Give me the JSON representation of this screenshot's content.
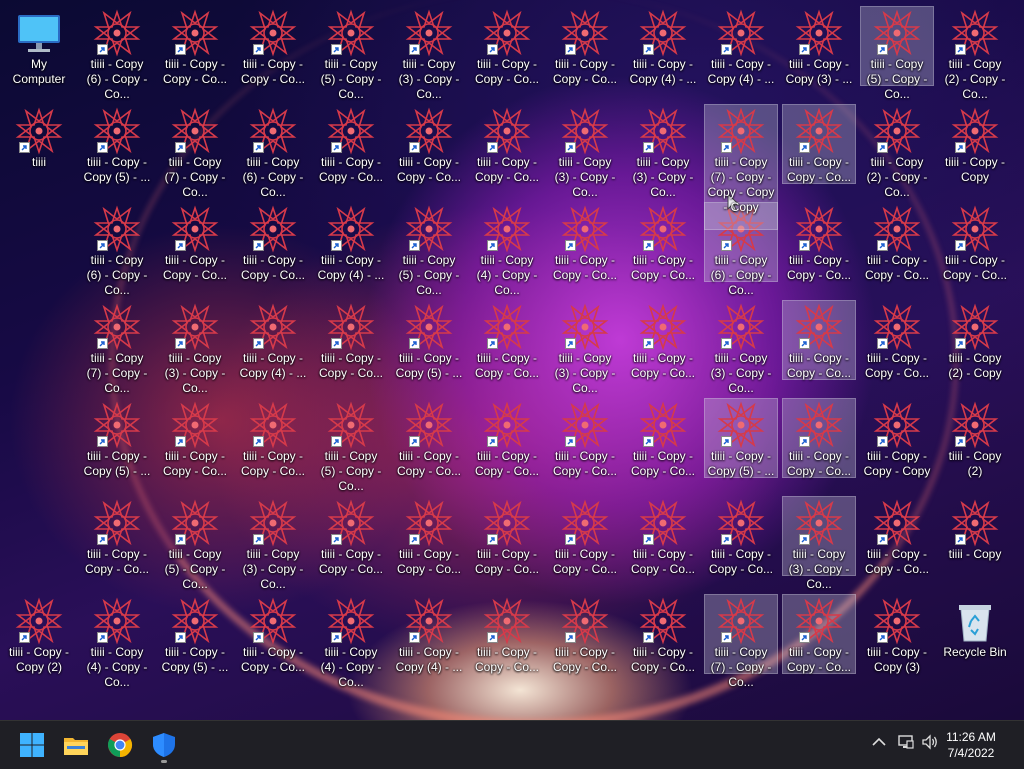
{
  "desktop": {
    "icons": [
      {
        "label": "My Computer",
        "kind": "computer",
        "col": 0,
        "row": 0
      },
      {
        "label": "tiiii - Copy (6) - Copy - Co...",
        "kind": "shortcut",
        "col": 1,
        "row": 0
      },
      {
        "label": "tiiii - Copy - Copy - Co...",
        "kind": "shortcut",
        "col": 2,
        "row": 0
      },
      {
        "label": "tiiii - Copy - Copy - Co...",
        "kind": "shortcut",
        "col": 3,
        "row": 0
      },
      {
        "label": "tiiii - Copy (5) - Copy - Co...",
        "kind": "shortcut",
        "col": 4,
        "row": 0
      },
      {
        "label": "tiiii - Copy (3) - Copy - Co...",
        "kind": "shortcut",
        "col": 5,
        "row": 0
      },
      {
        "label": "tiiii - Copy - Copy - Co...",
        "kind": "shortcut",
        "col": 6,
        "row": 0
      },
      {
        "label": "tiiii - Copy - Copy - Co...",
        "kind": "shortcut",
        "col": 7,
        "row": 0
      },
      {
        "label": "tiiii - Copy - Copy (4) - ...",
        "kind": "shortcut",
        "col": 8,
        "row": 0
      },
      {
        "label": "tiiii - Copy - Copy (4) - ...",
        "kind": "shortcut",
        "col": 9,
        "row": 0
      },
      {
        "label": "tiiii - Copy - Copy (3) - ...",
        "kind": "shortcut",
        "col": 10,
        "row": 0
      },
      {
        "label": "tiiii - Copy (5) - Copy - Co...",
        "kind": "shortcut",
        "col": 11,
        "row": 0,
        "selected": true
      },
      {
        "label": "tiiii - Copy (2) - Copy - Co...",
        "kind": "shortcut",
        "col": 12,
        "row": 0
      },
      {
        "label": "tiiii",
        "kind": "shortcut",
        "col": 0,
        "row": 1
      },
      {
        "label": "tiiii - Copy - Copy (5) - ...",
        "kind": "shortcut",
        "col": 1,
        "row": 1
      },
      {
        "label": "tiiii - Copy (7) - Copy - Co...",
        "kind": "shortcut",
        "col": 2,
        "row": 1
      },
      {
        "label": "tiiii - Copy (6) - Copy - Co...",
        "kind": "shortcut",
        "col": 3,
        "row": 1
      },
      {
        "label": "tiiii - Copy - Copy - Co...",
        "kind": "shortcut",
        "col": 4,
        "row": 1
      },
      {
        "label": "tiiii - Copy - Copy - Co...",
        "kind": "shortcut",
        "col": 5,
        "row": 1
      },
      {
        "label": "tiiii - Copy - Copy - Co...",
        "kind": "shortcut",
        "col": 6,
        "row": 1
      },
      {
        "label": "tiiii - Copy (3) - Copy - Co...",
        "kind": "shortcut",
        "col": 7,
        "row": 1
      },
      {
        "label": "tiiii - Copy (3) - Copy - Co...",
        "kind": "shortcut",
        "col": 8,
        "row": 1
      },
      {
        "label": "tiiii - Copy (7) - Copy - Copy - Copy - Copy",
        "kind": "shortcut",
        "col": 9,
        "row": 1,
        "selected": true,
        "expanded": true
      },
      {
        "label": "tiiii - Copy - Copy - Co...",
        "kind": "shortcut",
        "col": 10,
        "row": 1,
        "selected": true
      },
      {
        "label": "tiiii - Copy (2) - Copy - Co...",
        "kind": "shortcut",
        "col": 11,
        "row": 1
      },
      {
        "label": "tiiii - Copy - Copy",
        "kind": "shortcut",
        "col": 12,
        "row": 1
      },
      {
        "label": "tiiii - Copy (6) - Copy - Co...",
        "kind": "shortcut",
        "col": 1,
        "row": 2
      },
      {
        "label": "tiiii - Copy - Copy - Co...",
        "kind": "shortcut",
        "col": 2,
        "row": 2
      },
      {
        "label": "tiiii - Copy - Copy - Co...",
        "kind": "shortcut",
        "col": 3,
        "row": 2
      },
      {
        "label": "tiiii - Copy - Copy (4) - ...",
        "kind": "shortcut",
        "col": 4,
        "row": 2
      },
      {
        "label": "tiiii - Copy (5) - Copy - Co...",
        "kind": "shortcut",
        "col": 5,
        "row": 2
      },
      {
        "label": "tiiii - Copy (4) - Copy - Co...",
        "kind": "shortcut",
        "col": 6,
        "row": 2
      },
      {
        "label": "tiiii - Copy - Copy - Co...",
        "kind": "shortcut",
        "col": 7,
        "row": 2
      },
      {
        "label": "tiiii - Copy - Copy - Co...",
        "kind": "shortcut",
        "col": 8,
        "row": 2
      },
      {
        "label": "tiiii - Copy (6) - Copy - Co...",
        "kind": "shortcut",
        "col": 9,
        "row": 2,
        "selected": true
      },
      {
        "label": "tiiii - Copy - Copy - Co...",
        "kind": "shortcut",
        "col": 10,
        "row": 2
      },
      {
        "label": "tiiii - Copy - Copy - Co...",
        "kind": "shortcut",
        "col": 11,
        "row": 2
      },
      {
        "label": "tiiii - Copy - Copy - Co...",
        "kind": "shortcut",
        "col": 12,
        "row": 2
      },
      {
        "label": "tiiii - Copy (7) - Copy - Co...",
        "kind": "shortcut",
        "col": 1,
        "row": 3
      },
      {
        "label": "tiiii - Copy (3) - Copy - Co...",
        "kind": "shortcut",
        "col": 2,
        "row": 3
      },
      {
        "label": "tiiii - Copy - Copy (4) - ...",
        "kind": "shortcut",
        "col": 3,
        "row": 3
      },
      {
        "label": "tiiii - Copy - Copy - Co...",
        "kind": "shortcut",
        "col": 4,
        "row": 3
      },
      {
        "label": "tiiii - Copy - Copy (5) - ...",
        "kind": "shortcut",
        "col": 5,
        "row": 3
      },
      {
        "label": "tiiii - Copy - Copy - Co...",
        "kind": "shortcut",
        "col": 6,
        "row": 3
      },
      {
        "label": "tiiii - Copy (3) - Copy - Co...",
        "kind": "shortcut",
        "col": 7,
        "row": 3
      },
      {
        "label": "tiiii - Copy - Copy - Co...",
        "kind": "shortcut",
        "col": 8,
        "row": 3
      },
      {
        "label": "tiiii - Copy (3) - Copy - Co...",
        "kind": "shortcut",
        "col": 9,
        "row": 3
      },
      {
        "label": "tiiii - Copy - Copy - Co...",
        "kind": "shortcut",
        "col": 10,
        "row": 3,
        "selected": true
      },
      {
        "label": "tiiii - Copy - Copy - Co...",
        "kind": "shortcut",
        "col": 11,
        "row": 3
      },
      {
        "label": "tiiii - Copy (2) - Copy",
        "kind": "shortcut",
        "col": 12,
        "row": 3
      },
      {
        "label": "tiiii - Copy - Copy (5) - ...",
        "kind": "shortcut",
        "col": 1,
        "row": 4
      },
      {
        "label": "tiiii - Copy - Copy - Co...",
        "kind": "shortcut",
        "col": 2,
        "row": 4
      },
      {
        "label": "tiiii - Copy - Copy - Co...",
        "kind": "shortcut",
        "col": 3,
        "row": 4
      },
      {
        "label": "tiiii - Copy (5) - Copy - Co...",
        "kind": "shortcut",
        "col": 4,
        "row": 4
      },
      {
        "label": "tiiii - Copy - Copy - Co...",
        "kind": "shortcut",
        "col": 5,
        "row": 4
      },
      {
        "label": "tiiii - Copy - Copy - Co...",
        "kind": "shortcut",
        "col": 6,
        "row": 4
      },
      {
        "label": "tiiii - Copy - Copy - Co...",
        "kind": "shortcut",
        "col": 7,
        "row": 4
      },
      {
        "label": "tiiii - Copy - Copy - Co...",
        "kind": "shortcut",
        "col": 8,
        "row": 4
      },
      {
        "label": "tiiii - Copy - Copy (5) - ...",
        "kind": "shortcut",
        "col": 9,
        "row": 4,
        "selected": true
      },
      {
        "label": "tiiii - Copy - Copy - Co...",
        "kind": "shortcut",
        "col": 10,
        "row": 4,
        "selected": true
      },
      {
        "label": "tiiii - Copy - Copy - Copy",
        "kind": "shortcut",
        "col": 11,
        "row": 4
      },
      {
        "label": "tiiii - Copy (2)",
        "kind": "shortcut",
        "col": 12,
        "row": 4
      },
      {
        "label": "tiiii - Copy - Copy - Co...",
        "kind": "shortcut",
        "col": 1,
        "row": 5
      },
      {
        "label": "tiiii - Copy (5) - Copy - Co...",
        "kind": "shortcut",
        "col": 2,
        "row": 5
      },
      {
        "label": "tiiii - Copy (3) - Copy - Co...",
        "kind": "shortcut",
        "col": 3,
        "row": 5
      },
      {
        "label": "tiiii - Copy - Copy - Co...",
        "kind": "shortcut",
        "col": 4,
        "row": 5
      },
      {
        "label": "tiiii - Copy - Copy - Co...",
        "kind": "shortcut",
        "col": 5,
        "row": 5
      },
      {
        "label": "tiiii - Copy - Copy - Co...",
        "kind": "shortcut",
        "col": 6,
        "row": 5
      },
      {
        "label": "tiiii - Copy - Copy - Co...",
        "kind": "shortcut",
        "col": 7,
        "row": 5
      },
      {
        "label": "tiiii - Copy - Copy - Co...",
        "kind": "shortcut",
        "col": 8,
        "row": 5
      },
      {
        "label": "tiiii - Copy - Copy - Co...",
        "kind": "shortcut",
        "col": 9,
        "row": 5
      },
      {
        "label": "tiiii - Copy (3) - Copy - Co...",
        "kind": "shortcut",
        "col": 10,
        "row": 5,
        "selected": true
      },
      {
        "label": "tiiii - Copy - Copy - Co...",
        "kind": "shortcut",
        "col": 11,
        "row": 5
      },
      {
        "label": "tiiii - Copy",
        "kind": "shortcut",
        "col": 12,
        "row": 5
      },
      {
        "label": "tiiii - Copy - Copy (2)",
        "kind": "shortcut",
        "col": 0,
        "row": 6
      },
      {
        "label": "tiiii - Copy (4) - Copy - Co...",
        "kind": "shortcut",
        "col": 1,
        "row": 6
      },
      {
        "label": "tiiii - Copy - Copy (5) - ...",
        "kind": "shortcut",
        "col": 2,
        "row": 6
      },
      {
        "label": "tiiii - Copy - Copy - Co...",
        "kind": "shortcut",
        "col": 3,
        "row": 6
      },
      {
        "label": "tiiii - Copy (4) - Copy - Co...",
        "kind": "shortcut",
        "col": 4,
        "row": 6
      },
      {
        "label": "tiiii - Copy - Copy (4) - ...",
        "kind": "shortcut",
        "col": 5,
        "row": 6
      },
      {
        "label": "tiiii - Copy - Copy - Co...",
        "kind": "shortcut",
        "col": 6,
        "row": 6
      },
      {
        "label": "tiiii - Copy - Copy - Co...",
        "kind": "shortcut",
        "col": 7,
        "row": 6
      },
      {
        "label": "tiiii - Copy - Copy - Co...",
        "kind": "shortcut",
        "col": 8,
        "row": 6
      },
      {
        "label": "tiiii - Copy (7) - Copy - Co...",
        "kind": "shortcut",
        "col": 9,
        "row": 6,
        "selected": true
      },
      {
        "label": "tiiii - Copy - Copy - Co...",
        "kind": "shortcut",
        "col": 10,
        "row": 6,
        "selected": true
      },
      {
        "label": "tiiii - Copy - Copy (3)",
        "kind": "shortcut",
        "col": 11,
        "row": 6
      },
      {
        "label": "Recycle Bin",
        "kind": "recycle",
        "col": 12,
        "row": 6
      }
    ]
  },
  "taskbar": {
    "apps": [
      {
        "name": "start",
        "icon": "windows-start-icon"
      },
      {
        "name": "file-explorer",
        "icon": "folder-icon"
      },
      {
        "name": "chrome",
        "icon": "chrome-icon"
      },
      {
        "name": "defender",
        "icon": "shield-icon"
      }
    ],
    "tray": {
      "overflow_icon": "chevron-up-icon",
      "network_icon": "network-icon",
      "volume_icon": "speaker-icon"
    },
    "clock": {
      "time": "11:26 AM",
      "date": "7/4/2022"
    }
  },
  "colors": {
    "taskbar_bg": "#1f1f25",
    "selection_bg": "rgba(200,200,220,0.33)",
    "shortcut_icon": "#d63a4a"
  }
}
